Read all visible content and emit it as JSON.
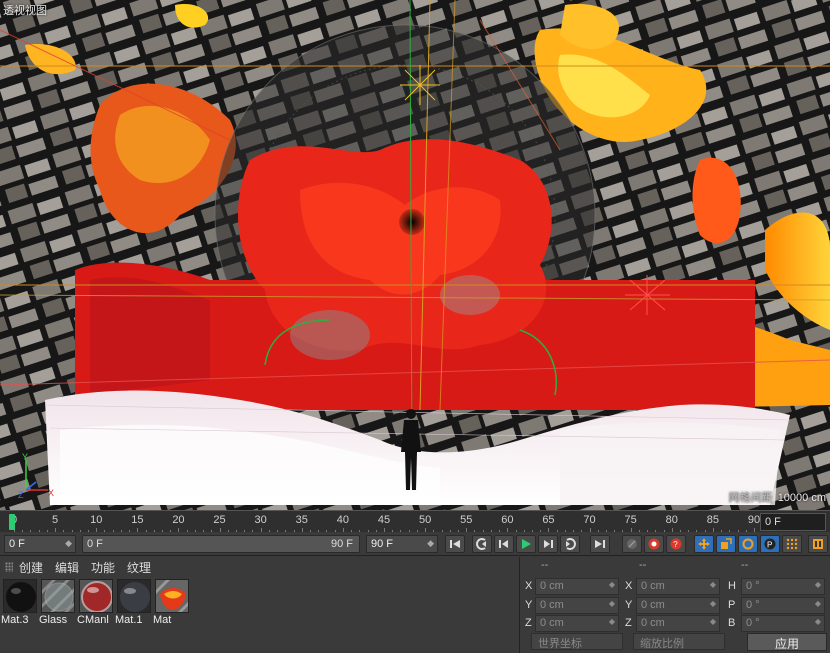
{
  "viewport": {
    "title": "透视视图",
    "grid_label": "网格间距",
    "grid_value": "10000 cm"
  },
  "timeline": {
    "ticks": [
      "0",
      "5",
      "10",
      "15",
      "20",
      "25",
      "30",
      "35",
      "40",
      "45",
      "50",
      "55",
      "60",
      "65",
      "70",
      "75",
      "80",
      "85",
      "90"
    ],
    "playhead_value": 0,
    "current_frame": "0 F"
  },
  "transport": {
    "start_field": "0 F",
    "range_left": "0 F",
    "range_right": "90 F",
    "end_field": "90 F"
  },
  "materials": {
    "menu": [
      "创建",
      "编辑",
      "功能",
      "纹理"
    ],
    "items": [
      {
        "name": "Mat.3"
      },
      {
        "name": "Glass"
      },
      {
        "name": "CManl"
      },
      {
        "name": "Mat.1"
      },
      {
        "name": "Mat"
      }
    ]
  },
  "coords": {
    "col_headers": [
      "--",
      "--",
      "--"
    ],
    "rows": [
      {
        "a_label": "X",
        "a_value": "0 cm",
        "b_label": "X",
        "b_value": "0 cm",
        "c_label": "H",
        "c_value": "0 °"
      },
      {
        "a_label": "Y",
        "a_value": "0 cm",
        "b_label": "Y",
        "b_value": "0 cm",
        "c_label": "P",
        "c_value": "0 °"
      },
      {
        "a_label": "Z",
        "a_value": "0 cm",
        "b_label": "Z",
        "b_value": "0 cm",
        "c_label": "B",
        "c_value": "0 °"
      }
    ],
    "world_coords": "世界坐标",
    "scale_mode": "缩放比例",
    "apply": "应用"
  },
  "colors": {
    "playhead": "#2ecc71",
    "accent_blue": "#2e6fb8",
    "lava_red": "#e0241a",
    "lava_yellow": "#ffd21a"
  }
}
